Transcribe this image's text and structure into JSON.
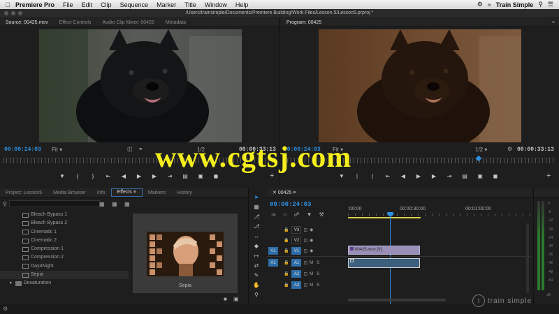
{
  "menubar": {
    "apple_icon": "apple-logo-icon",
    "app_name": "Premiere Pro",
    "items": [
      "File",
      "Edit",
      "Clip",
      "Sequence",
      "Marker",
      "Title",
      "Window",
      "Help"
    ],
    "brand": "Train Simple"
  },
  "window": {
    "title": "/Users/trainsimple/Documents/Premiere Building/Work Files/Lesson 5/Lesson5.prproj *"
  },
  "source_panel": {
    "tabs": [
      "Source: 00425.mov",
      "Effect Controls",
      "Audio Clip Mixer: 00425",
      "Metadata"
    ],
    "active_tab": 0,
    "timecode": "00:00:24:03",
    "fit": "Fit",
    "resolution": "1/2",
    "duration": "00:00:33:13"
  },
  "program_panel": {
    "tabs": [
      "Program: 00425"
    ],
    "timecode": "00:00:24:03",
    "fit": "Fit",
    "resolution": "1/2",
    "duration": "00:00:33:13"
  },
  "watermark": "www.cgtsj.com",
  "project_panel": {
    "tabs": [
      "Project: Lesson5",
      "Media Browser",
      "Info",
      "Effects",
      "Markers",
      "History"
    ],
    "active_tab": 3,
    "search_placeholder": "",
    "effects": [
      "Bleach Bypass 1",
      "Bleach Bypass 2",
      "Cinematic 1",
      "Cinematic 2",
      "Compression 1",
      "Compression 2",
      "Day4Night",
      "Sepia"
    ],
    "selected_effect": "Sepia",
    "folder": "Desaturation",
    "preview_label": "Sepia"
  },
  "timeline": {
    "tab": "00425",
    "timecode": "00:00:24:03",
    "ruler_labels": [
      ":00:00",
      "00:00:30:00",
      "00:01:00:00"
    ],
    "video_tracks": [
      {
        "name": "V3",
        "target": ""
      },
      {
        "name": "V2",
        "target": ""
      },
      {
        "name": "V1",
        "target": "V1"
      }
    ],
    "audio_tracks": [
      {
        "name": "A1",
        "target": "A1"
      },
      {
        "name": "A2",
        "target": ""
      },
      {
        "name": "A3",
        "target": ""
      }
    ],
    "mute_label": "M",
    "solo_label": "S",
    "video_clip": "00425.mov [V]",
    "playhead_fraction": 0.23
  },
  "audio_meter": {
    "labels": [
      "0",
      "-6",
      "-12",
      "-18",
      "-24",
      "-30",
      "-36",
      "-42",
      "-48",
      "-54"
    ],
    "unit": "dB"
  },
  "brand_watermark": "train simple",
  "colors": {
    "accent_blue": "#2f8fe0",
    "track_target": "#2d6da8",
    "watermark_yellow": "#f4ef1c"
  }
}
